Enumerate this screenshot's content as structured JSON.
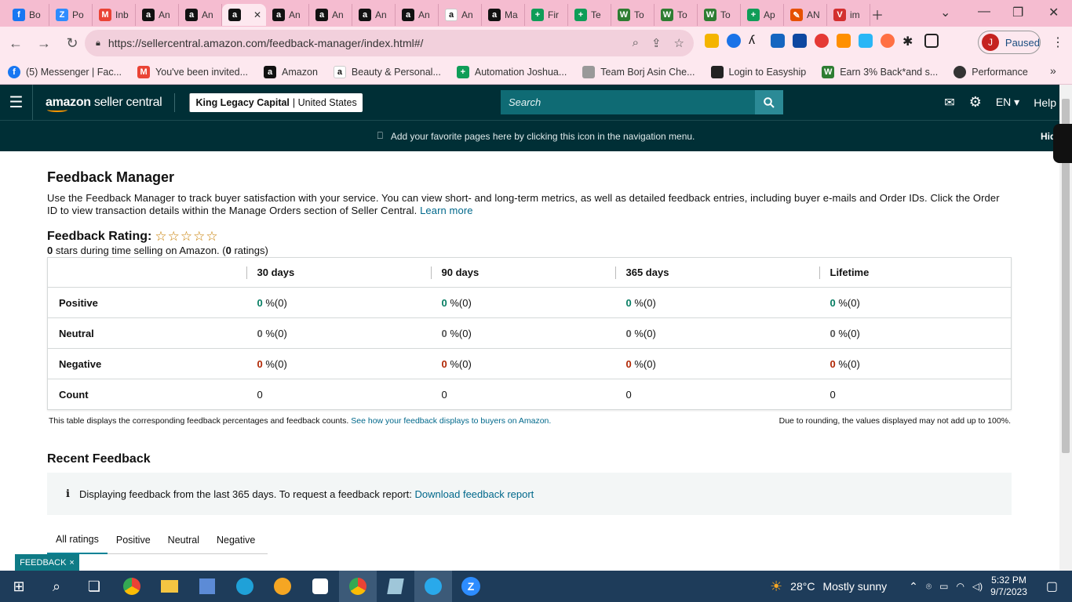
{
  "browser": {
    "tabs": [
      {
        "label": "Bo",
        "icon": "facebook-icon",
        "color": "#1877f2"
      },
      {
        "label": "Po",
        "icon": "zoom-icon",
        "color": "#2d8cff"
      },
      {
        "label": "Inb",
        "icon": "gmail-icon",
        "color": "#ea4335"
      },
      {
        "label": "An",
        "icon": "amazon-icon",
        "color": "#111111"
      },
      {
        "label": "An",
        "icon": "amazon-icon",
        "color": "#111111"
      },
      {
        "label": "",
        "icon": "amazon-icon",
        "color": "#111111",
        "active": true
      },
      {
        "label": "An",
        "icon": "amazon-icon",
        "color": "#111111"
      },
      {
        "label": "An",
        "icon": "amazon-icon",
        "color": "#111111"
      },
      {
        "label": "An",
        "icon": "amazon-icon",
        "color": "#111111"
      },
      {
        "label": "An",
        "icon": "amazon-icon",
        "color": "#111111"
      },
      {
        "label": "An",
        "icon": "amazon-smile-icon",
        "color": "#ffffff"
      },
      {
        "label": "Ma",
        "icon": "amazon-icon",
        "color": "#111111"
      },
      {
        "label": "Fir",
        "icon": "plus-sheet-icon",
        "color": "#0f9d58"
      },
      {
        "label": "Te",
        "icon": "plus-sheet-icon",
        "color": "#0f9d58"
      },
      {
        "label": "To",
        "icon": "w-logo-icon",
        "color": "#2e7d32"
      },
      {
        "label": "To",
        "icon": "w-logo-icon",
        "color": "#2e7d32"
      },
      {
        "label": "To",
        "icon": "w-logo-icon",
        "color": "#2e7d32"
      },
      {
        "label": "Ap",
        "icon": "plus-sheet-icon",
        "color": "#0f9d58"
      },
      {
        "label": "AN",
        "icon": "pen-icon",
        "color": "#e65100"
      },
      {
        "label": "im",
        "icon": "vivaldi-icon",
        "color": "#d32f2f"
      }
    ],
    "url": "https://sellercentral.amazon.com/feedback-manager/index.html#/",
    "profile_initial": "J",
    "profile_status": "Paused",
    "bookmarks": [
      {
        "label": "(5) Messenger | Fac...",
        "icon": "facebook-icon"
      },
      {
        "label": "You've been invited...",
        "icon": "gmail-icon"
      },
      {
        "label": "Amazon",
        "icon": "amazon-icon"
      },
      {
        "label": "Beauty & Personal...",
        "icon": "amazon-smile-icon"
      },
      {
        "label": "Automation Joshua...",
        "icon": "plus-sheet-icon"
      },
      {
        "label": "Team Borj Asin Che...",
        "icon": "signature-icon"
      },
      {
        "label": "Login to Easyship",
        "icon": "easyship-icon"
      },
      {
        "label": "Earn 3% Back*and s...",
        "icon": "w-logo-icon"
      },
      {
        "label": "Performance",
        "icon": "performance-icon"
      }
    ]
  },
  "header": {
    "logo_main": "amazon",
    "logo_sub": " seller central",
    "store_name": "King Legacy Capital",
    "store_region": "United States",
    "search_placeholder": "Search",
    "language": "EN",
    "help": "Help"
  },
  "favbar": {
    "message": "Add your favorite pages here by clicking this icon in the navigation menu.",
    "hide": "Hide"
  },
  "page": {
    "title": "Feedback Manager",
    "description": "Use the Feedback Manager to track buyer satisfaction with your service. You can view short- and long-term metrics, as well as detailed feedback entries, including buyer e-mails and Order IDs. Click the Order ID to view transaction details within the Manage Orders section of Seller Central.",
    "learn_more": "Learn more",
    "rating_label": "Feedback Rating:",
    "stars_value": 0,
    "stars_max": 5,
    "stars_glyphs": "☆☆☆☆☆",
    "summary_stars": "0",
    "summary_text_1": " stars during time selling on Amazon. (",
    "summary_ratings": "0",
    "summary_text_2": " ratings)"
  },
  "table": {
    "columns": [
      "",
      "30 days",
      "90 days",
      "365 days",
      "Lifetime"
    ],
    "rows": [
      {
        "label": "Positive",
        "cells": [
          {
            "num": "0",
            "rest": " %(0)"
          },
          {
            "num": "0",
            "rest": " %(0)"
          },
          {
            "num": "0",
            "rest": " %(0)"
          },
          {
            "num": "0",
            "rest": " %(0)"
          }
        ]
      },
      {
        "label": "Neutral",
        "cells": [
          {
            "num": "0",
            "rest": " %(0)"
          },
          {
            "num": "0",
            "rest": " %(0)"
          },
          {
            "num": "0",
            "rest": " %(0)"
          },
          {
            "num": "0",
            "rest": " %(0)"
          }
        ]
      },
      {
        "label": "Negative",
        "cells": [
          {
            "num": "0",
            "rest": " %(0)"
          },
          {
            "num": "0",
            "rest": " %(0)"
          },
          {
            "num": "0",
            "rest": " %(0)"
          },
          {
            "num": "0",
            "rest": " %(0)"
          }
        ]
      },
      {
        "label": "Count",
        "cells": [
          {
            "num": "",
            "rest": "0"
          },
          {
            "num": "",
            "rest": "0"
          },
          {
            "num": "",
            "rest": "0"
          },
          {
            "num": "",
            "rest": "0"
          }
        ]
      }
    ],
    "note_left": "This table displays the corresponding feedback percentages and feedback counts.",
    "note_link": "See how your feedback displays to buyers on Amazon.",
    "note_right": "Due to rounding, the values displayed may not add up to 100%."
  },
  "recent": {
    "title": "Recent Feedback",
    "info": "Displaying feedback from the last 365 days. To request a feedback report:",
    "download": "Download feedback report",
    "tabs": [
      "All ratings",
      "Positive",
      "Neutral",
      "Negative"
    ]
  },
  "feedback_button": "FEEDBACK",
  "taskbar": {
    "weather_temp": "28°C",
    "weather_desc": "Mostly sunny",
    "time": "5:32 PM",
    "date": "9/7/2023"
  },
  "colors": {
    "positive": "#067d62",
    "neutral": "#555555",
    "negative": "#b12704",
    "header_bg": "#002f36",
    "tabbar_bg": "#f5bcd0"
  }
}
